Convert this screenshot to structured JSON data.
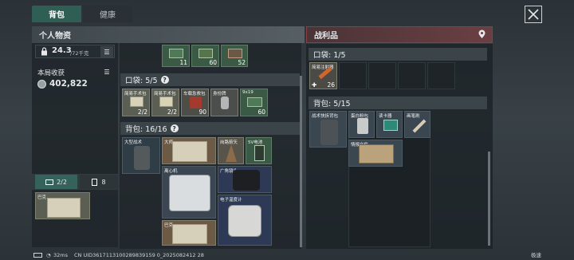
{
  "tabs": [
    {
      "label": "背包"
    },
    {
      "label": "健康"
    }
  ],
  "personal": {
    "title": "个人物资",
    "weight_value": "24.3",
    "weight_cap": "/72千克",
    "earnings_label": "本局收获",
    "earnings_value": "402,822"
  },
  "equip_tabs": [
    {
      "label": "2/2"
    },
    {
      "label": "8"
    }
  ],
  "equip_item": {
    "name": "巴克"
  },
  "top_row": [
    {
      "count": "11"
    },
    {
      "count": "60"
    },
    {
      "count": "52"
    }
  ],
  "pocket": {
    "title": "口袋: 5/5",
    "items": [
      {
        "name": "简易手术包",
        "value": "2/2"
      },
      {
        "name": "简易手术包",
        "value": "2/2"
      },
      {
        "name": "车载急救包",
        "value": "90"
      },
      {
        "name": "身份牌",
        "value": ""
      },
      {
        "name": "9x19",
        "value": "60"
      }
    ]
  },
  "backpack": {
    "title": "背包: 16/16",
    "items": [
      {
        "name": "大型战术"
      },
      {
        "name": "大师"
      },
      {
        "name": "岗路箭矢"
      },
      {
        "name": "5V电池"
      },
      {
        "name": "离心机"
      },
      {
        "name": "广角镜头"
      },
      {
        "name": "电子温度计"
      },
      {
        "name": "巴克"
      }
    ]
  },
  "loot": {
    "title": "战利品",
    "pocket_title": "口袋: 1/5",
    "pocket_item": {
      "name": "简易注射器",
      "value": "26"
    },
    "backpack_title": "背包: 5/15",
    "items": [
      {
        "name": "战术快拆背包"
      },
      {
        "name": "蛋白粉包"
      },
      {
        "name": "读卡器"
      },
      {
        "name": "画笔刷"
      },
      {
        "name": "情报文件"
      }
    ]
  },
  "footer": {
    "ping": "32ms",
    "uid": "CN UID3617113100289839159 0_2025082412 28",
    "right": "极速"
  }
}
